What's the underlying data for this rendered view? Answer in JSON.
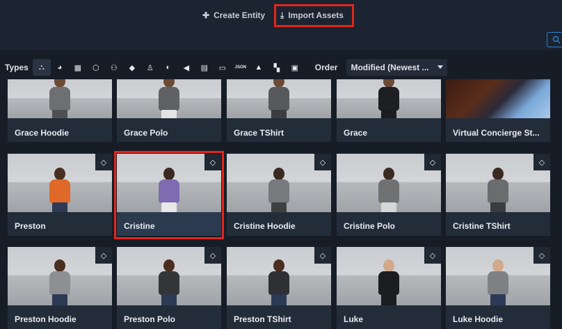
{
  "header": {
    "create_entity_label": "Create Entity",
    "import_assets_label": "Import Assets",
    "search_icon": "search-icon"
  },
  "toolbar": {
    "types_label": "Types",
    "type_icons": [
      "all-types-icon",
      "shape-icon",
      "film-icon",
      "polygon-icon",
      "multi-person-icon",
      "cube-icon",
      "person-icon",
      "sphere-icon",
      "audio-icon",
      "document-icon",
      "chat-icon",
      "json-icon",
      "terrain-icon",
      "layout-icon",
      "texture-icon"
    ],
    "json_label": "JSON",
    "order_label": "Order",
    "order_value": "Modified (Newest ..."
  },
  "assets": [
    {
      "title": "Grace Hoodie"
    },
    {
      "title": "Grace Polo"
    },
    {
      "title": "Grace TShirt"
    },
    {
      "title": "Grace"
    },
    {
      "title": "Virtual Concierge St..."
    },
    {
      "title": "Preston"
    },
    {
      "title": "Cristine"
    },
    {
      "title": "Cristine Hoodie"
    },
    {
      "title": "Cristine Polo"
    },
    {
      "title": "Cristine TShirt"
    },
    {
      "title": "Preston Hoodie"
    },
    {
      "title": "Preston Polo"
    },
    {
      "title": "Preston TShirt"
    },
    {
      "title": "Luke"
    },
    {
      "title": "Luke Hoodie"
    }
  ],
  "colors": {
    "highlight": "#e2261b",
    "background": "#161d27",
    "card": "#232d3a",
    "selected_card": "#2c3a4f"
  }
}
